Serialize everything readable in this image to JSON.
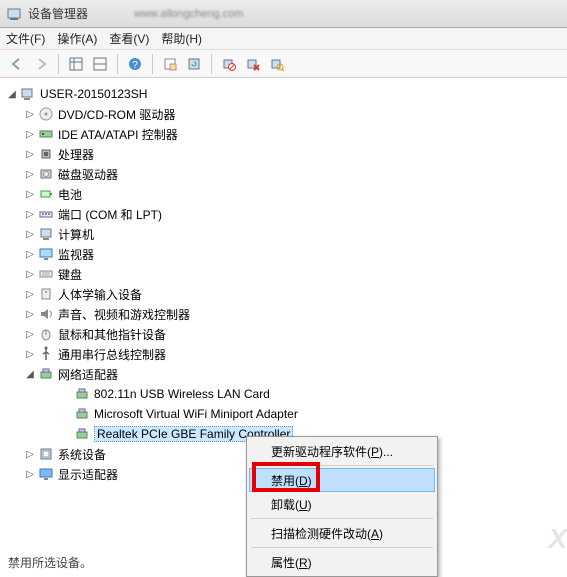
{
  "window": {
    "title": "设备管理器",
    "url_blur": "www.allongcheng.com"
  },
  "menu": {
    "file": "文件(F)",
    "action": "操作(A)",
    "view": "查看(V)",
    "help": "帮助(H)"
  },
  "toolbar_icons": [
    "back",
    "forward",
    "sep",
    "grid1",
    "grid2",
    "sep",
    "help",
    "sep",
    "props",
    "refresh",
    "sep",
    "disable",
    "uninstall",
    "scan"
  ],
  "tree": {
    "root": {
      "label": "USER-20150123SH",
      "expanded": true
    },
    "cats": [
      {
        "label": "DVD/CD-ROM 驱动器",
        "icon": "disc",
        "expanded": false
      },
      {
        "label": "IDE ATA/ATAPI 控制器",
        "icon": "ide",
        "expanded": false
      },
      {
        "label": "处理器",
        "icon": "cpu",
        "expanded": false
      },
      {
        "label": "磁盘驱动器",
        "icon": "disk",
        "expanded": false
      },
      {
        "label": "电池",
        "icon": "battery",
        "expanded": false
      },
      {
        "label": "端口 (COM 和 LPT)",
        "icon": "port",
        "expanded": false
      },
      {
        "label": "计算机",
        "icon": "computer",
        "expanded": false
      },
      {
        "label": "监视器",
        "icon": "monitor",
        "expanded": false
      },
      {
        "label": "键盘",
        "icon": "keyboard",
        "expanded": false
      },
      {
        "label": "人体学输入设备",
        "icon": "hid",
        "expanded": false
      },
      {
        "label": "声音、视频和游戏控制器",
        "icon": "sound",
        "expanded": false
      },
      {
        "label": "鼠标和其他指针设备",
        "icon": "mouse",
        "expanded": false
      },
      {
        "label": "通用串行总线控制器",
        "icon": "usb",
        "expanded": false
      },
      {
        "label": "网络适配器",
        "icon": "net",
        "expanded": true,
        "children": [
          {
            "label": "802.11n USB Wireless LAN Card",
            "icon": "net"
          },
          {
            "label": "Microsoft Virtual WiFi Miniport Adapter",
            "icon": "net"
          },
          {
            "label": "Realtek PCIe GBE Family Controller",
            "icon": "net",
            "selected": true
          }
        ]
      },
      {
        "label": "系统设备",
        "icon": "system",
        "expanded": false
      },
      {
        "label": "显示适配器",
        "icon": "display",
        "expanded": false
      }
    ]
  },
  "context_menu": {
    "update_driver": "更新驱动程序软件(P)...",
    "disable": "禁用(D)",
    "uninstall": "卸载(U)",
    "scan": "扫描检测硬件改动(A)",
    "properties": "属性(R)",
    "underline": {
      "update_driver": "P",
      "disable": "D",
      "uninstall": "U",
      "scan": "A",
      "properties": "R"
    }
  },
  "status": "禁用所选设备。",
  "watermark": "X"
}
